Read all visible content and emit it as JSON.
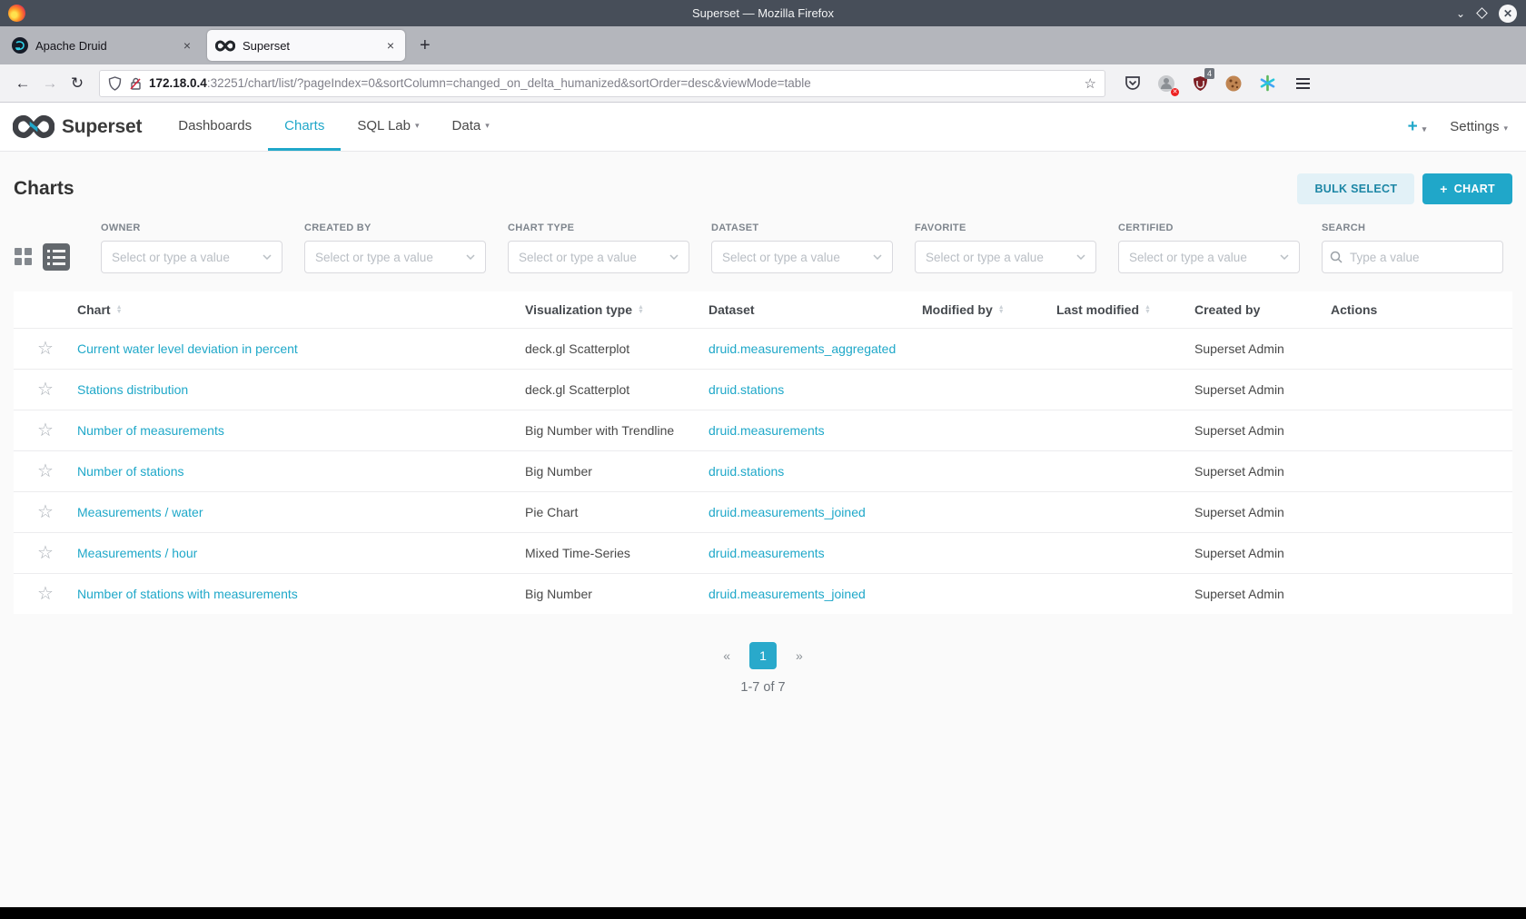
{
  "window": {
    "title": "Superset — Mozilla Firefox",
    "tabs": [
      {
        "label": "Apache Druid"
      },
      {
        "label": "Superset"
      }
    ],
    "close_tab": "×",
    "new_tab": "+",
    "url_host": "172.18.0.4",
    "url_rest": ":32251/chart/list/?pageIndex=0&sortColumn=changed_on_delta_humanized&sortOrder=desc&viewMode=table",
    "shield_badge": "4"
  },
  "navbar": {
    "brand": "Superset",
    "items": [
      {
        "label": "Dashboards",
        "active": false,
        "caret": false
      },
      {
        "label": "Charts",
        "active": true,
        "caret": false
      },
      {
        "label": "SQL Lab",
        "active": false,
        "caret": true
      },
      {
        "label": "Data",
        "active": false,
        "caret": true
      }
    ],
    "plus_label": "+",
    "settings_label": "Settings"
  },
  "page": {
    "title": "Charts",
    "bulk_select_label": "BULK SELECT",
    "new_chart_plus": "+",
    "new_chart_label": "CHART"
  },
  "filters": {
    "fields": [
      "OWNER",
      "CREATED BY",
      "CHART TYPE",
      "DATASET",
      "FAVORITE",
      "CERTIFIED"
    ],
    "select_placeholder": "Select or type a value",
    "search_label": "SEARCH",
    "search_placeholder": "Type a value"
  },
  "table": {
    "columns": [
      {
        "label": "Chart",
        "sortable": true
      },
      {
        "label": "Visualization type",
        "sortable": true
      },
      {
        "label": "Dataset",
        "sortable": false
      },
      {
        "label": "Modified by",
        "sortable": true
      },
      {
        "label": "Last modified",
        "sortable": true
      },
      {
        "label": "Created by",
        "sortable": false
      },
      {
        "label": "Actions",
        "sortable": false
      }
    ],
    "rows": [
      {
        "chart": "Current water level deviation in percent",
        "viz_type": "deck.gl Scatterplot",
        "dataset": "druid.measurements_aggregated",
        "modified_by": "",
        "last_modified": "",
        "created_by": "Superset Admin"
      },
      {
        "chart": "Stations distribution",
        "viz_type": "deck.gl Scatterplot",
        "dataset": "druid.stations",
        "modified_by": "",
        "last_modified": "",
        "created_by": "Superset Admin"
      },
      {
        "chart": "Number of measurements",
        "viz_type": "Big Number with Trendline",
        "dataset": "druid.measurements",
        "modified_by": "",
        "last_modified": "",
        "created_by": "Superset Admin"
      },
      {
        "chart": "Number of stations",
        "viz_type": "Big Number",
        "dataset": "druid.stations",
        "modified_by": "",
        "last_modified": "",
        "created_by": "Superset Admin"
      },
      {
        "chart": "Measurements / water",
        "viz_type": "Pie Chart",
        "dataset": "druid.measurements_joined",
        "modified_by": "",
        "last_modified": "",
        "created_by": "Superset Admin"
      },
      {
        "chart": "Measurements / hour",
        "viz_type": "Mixed Time-Series",
        "dataset": "druid.measurements",
        "modified_by": "",
        "last_modified": "",
        "created_by": "Superset Admin"
      },
      {
        "chart": "Number of stations with measurements",
        "viz_type": "Big Number",
        "dataset": "druid.measurements_joined",
        "modified_by": "",
        "last_modified": "",
        "created_by": "Superset Admin"
      }
    ]
  },
  "pagination": {
    "prev": "«",
    "active_page": "1",
    "next": "»",
    "summary": "1-7 of 7"
  },
  "colors": {
    "accent": "#20a7c9",
    "link": "#1fa8c9",
    "titlebar": "#474e59",
    "ext_shield": "#7d1f24"
  }
}
